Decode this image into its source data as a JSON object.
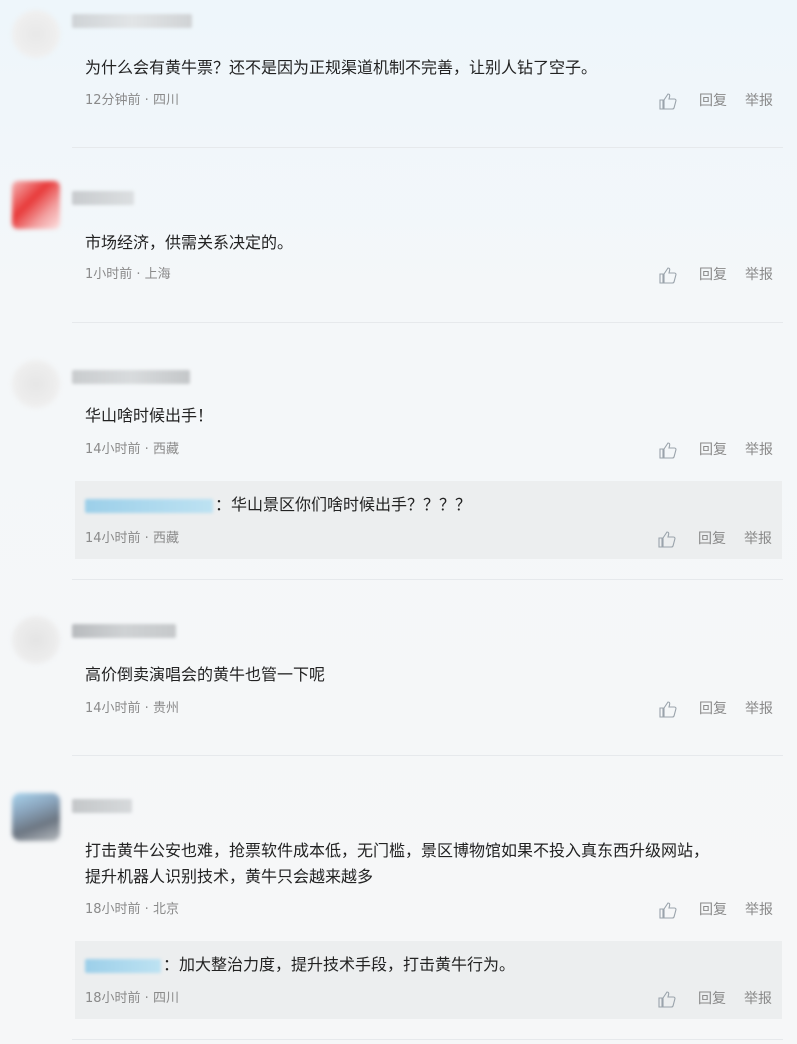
{
  "actions": {
    "reply": "回复",
    "report": "举报"
  },
  "comments": [
    {
      "text": "为什么会有黄牛票？还不是因为正规渠道机制不完善，让别人钻了空子。",
      "meta": "12分钟前 · 四川"
    },
    {
      "text": "市场经济，供需关系决定的。",
      "meta": "1小时前 · 上海"
    },
    {
      "text": "华山啥时候出手！",
      "meta": "14小时前 · 西藏",
      "reply": {
        "text": "：华山景区你们啥时候出手？？？？",
        "meta": "14小时前 · 西藏"
      }
    },
    {
      "text": "高价倒卖演唱会的黄牛也管一下呢",
      "meta": "14小时前 · 贵州"
    },
    {
      "text_line1": "打击黄牛公安也难，抢票软件成本低，无门槛，景区博物馆如果不投入真东西升级网站，",
      "text_line2": "提升机器人识别技术，黄牛只会越来越多",
      "meta": "18小时前 · 北京",
      "reply": {
        "text": "：加大整治力度，提升技术手段，打击黄牛行为。",
        "meta": "18小时前 · 四川"
      }
    }
  ]
}
